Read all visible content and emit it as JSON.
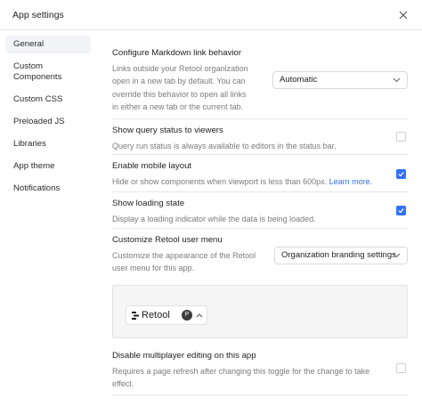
{
  "header": {
    "title": "App settings",
    "close_icon": "close-icon"
  },
  "sidebar": {
    "items": [
      {
        "label": "General",
        "active": true
      },
      {
        "label": "Custom Components",
        "active": false
      },
      {
        "label": "Custom CSS",
        "active": false
      },
      {
        "label": "Preloaded JS",
        "active": false
      },
      {
        "label": "Libraries",
        "active": false
      },
      {
        "label": "App theme",
        "active": false
      },
      {
        "label": "Notifications",
        "active": false
      }
    ]
  },
  "settings": {
    "markdown": {
      "title": "Configure Markdown link behavior",
      "desc": "Links outside your Retool organization open in a new tab by default. You can override this behavior to open all links in either a new tab or the current tab.",
      "select_value": "Automatic"
    },
    "query_status": {
      "title": "Show query status to viewers",
      "desc": "Query run status is always available to editors in the status bar.",
      "checked": false
    },
    "mobile_layout": {
      "title": "Enable mobile layout",
      "desc": "Hide or show components when viewport is less than 600px.",
      "link": "Learn more.",
      "checked": true
    },
    "loading_state": {
      "title": "Show loading state",
      "desc": "Display a loading indicator while the data is being loaded.",
      "checked": true
    },
    "user_menu": {
      "title": "Customize Retool user menu",
      "desc": "Customize the appearance of the Retool user menu for this app.",
      "select_value": "Organization branding settings"
    },
    "preview": {
      "brand": "Retool",
      "avatar_initial": "P"
    },
    "multiplayer": {
      "title": "Disable multiplayer editing on this app",
      "desc": "Requires a page refresh after changing this toggle for the change to take effect.",
      "checked": false
    }
  },
  "colors": {
    "accent": "#3170f9",
    "active_nav_bg": "#f3f4f7",
    "divider": "#e8e8e8"
  }
}
